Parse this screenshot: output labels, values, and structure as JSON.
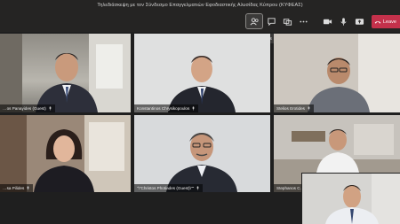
{
  "window": {
    "title": "Τηλεδιάσκεψη με τον Σύνδεσμο Επαγγελματιών Εφοδιαστικής Αλυσίδας Κύπρου (ΚΥΦΕΑΣ)"
  },
  "toolbar": {
    "participants_tooltip": "Show participants",
    "leave_label": "Leave"
  },
  "participants": [
    {
      "name": "…os Panayides (Guest)"
    },
    {
      "name": "Konstantinos Chrysikopoulos"
    },
    {
      "name": "Stelios Erotides"
    },
    {
      "name": "…sa Pilides"
    },
    {
      "name": "\"\\\"Christos Photiades (Guest)\\\"\""
    },
    {
      "name": "Stephanos C…"
    }
  ],
  "colors": {
    "leave": "#c4314b",
    "topbar": "#252423",
    "stage": "#1f1f1f"
  }
}
